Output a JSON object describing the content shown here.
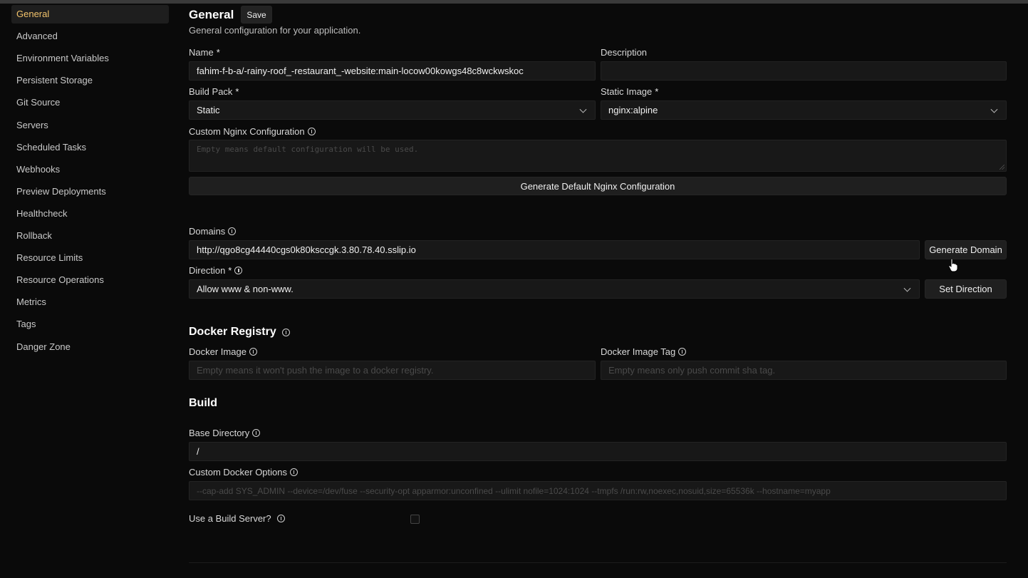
{
  "sidebar": {
    "items": [
      {
        "label": "General",
        "active": true
      },
      {
        "label": "Advanced"
      },
      {
        "label": "Environment Variables"
      },
      {
        "label": "Persistent Storage"
      },
      {
        "label": "Git Source"
      },
      {
        "label": "Servers"
      },
      {
        "label": "Scheduled Tasks"
      },
      {
        "label": "Webhooks"
      },
      {
        "label": "Preview Deployments"
      },
      {
        "label": "Healthcheck"
      },
      {
        "label": "Rollback"
      },
      {
        "label": "Resource Limits"
      },
      {
        "label": "Resource Operations"
      },
      {
        "label": "Metrics"
      },
      {
        "label": "Tags"
      },
      {
        "label": "Danger Zone"
      }
    ]
  },
  "header": {
    "title": "General",
    "save_label": "Save",
    "description": "General configuration for your application."
  },
  "form": {
    "name": {
      "label": "Name",
      "required": "*",
      "value": "fahim-f-b-a/-rainy-roof_-restaurant_-website:main-locow00kowgs48c8wckwskoc"
    },
    "description": {
      "label": "Description",
      "value": ""
    },
    "build_pack": {
      "label": "Build Pack",
      "required": "*",
      "value": "Static"
    },
    "static_image": {
      "label": "Static Image",
      "required": "*",
      "value": "nginx:alpine"
    },
    "custom_nginx": {
      "label": "Custom Nginx Configuration",
      "placeholder": "Empty means default configuration will be used."
    },
    "generate_nginx_label": "Generate Default Nginx Configuration",
    "domains": {
      "label": "Domains",
      "value": "http://qgo8cg44440cgs0k80ksccgk.3.80.78.40.sslip.io"
    },
    "generate_domain_label": "Generate Domain",
    "direction": {
      "label": "Direction",
      "required": "*",
      "value": "Allow www & non-www."
    },
    "set_direction_label": "Set Direction"
  },
  "docker_registry": {
    "title": "Docker Registry",
    "image": {
      "label": "Docker Image",
      "placeholder": "Empty means it won't push the image to a docker registry."
    },
    "tag": {
      "label": "Docker Image Tag",
      "placeholder": "Empty means only push commit sha tag."
    }
  },
  "build": {
    "title": "Build",
    "base_directory": {
      "label": "Base Directory",
      "value": "/"
    },
    "custom_docker_options": {
      "label": "Custom Docker Options",
      "placeholder": "--cap-add SYS_ADMIN --device=/dev/fuse --security-opt apparmor:unconfined --ulimit nofile=1024:1024 --tmpfs /run:rw,noexec,nosuid,size=65536k --hostname=myapp"
    },
    "build_server": {
      "label": "Use a Build Server?",
      "checked": false
    }
  },
  "colors": {
    "accent": "#f2c36b",
    "background": "#0a0a0a",
    "field": "#181818"
  },
  "icons": {
    "info": "info-circle-icon",
    "chevron": "chevron-down-icon",
    "cursor": "hand-pointer-icon"
  }
}
